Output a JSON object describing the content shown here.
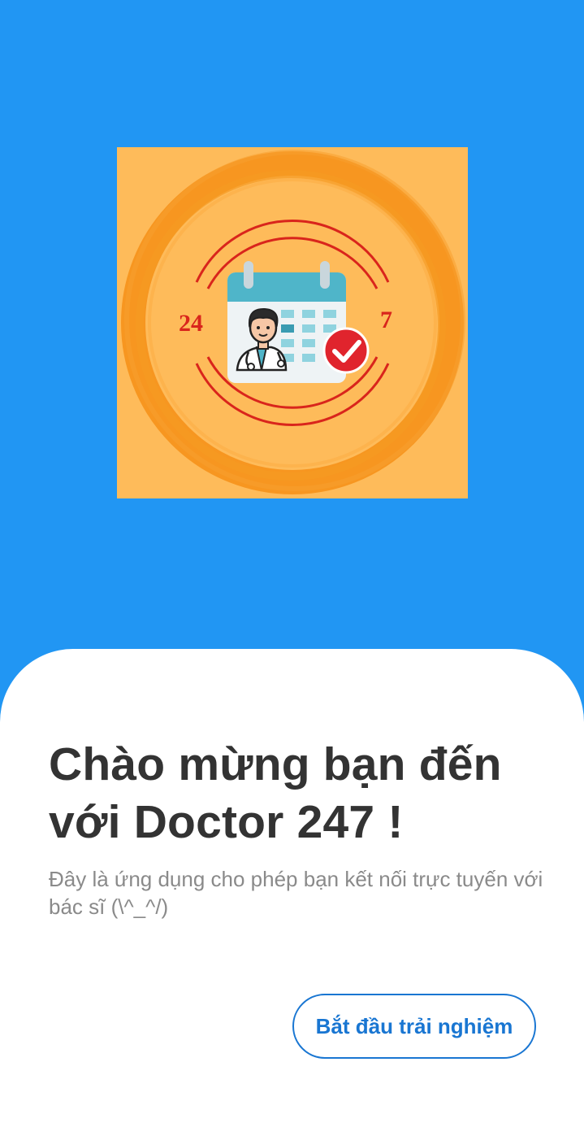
{
  "logo": {
    "icon": "doctor-calendar-24-7-logo",
    "left_label": "24",
    "right_label": "7",
    "colors": {
      "background": "#FEBB5A",
      "brush_ring": "#F7931E",
      "red_arcs": "#D9251C",
      "calendar_header": "#4FB5C9",
      "check_badge": "#E0242D"
    }
  },
  "welcome": {
    "title": "Chào mừng bạn đến với Doctor 247 !",
    "subtitle": "Đây là ứng dụng cho phép bạn kết nối trực tuyến với bác sĩ (\\^_^/)"
  },
  "actions": {
    "start_label": "Bắt đầu trải nghiệm"
  },
  "theme": {
    "primary": "#2196F3",
    "button_accent": "#1976D2"
  }
}
